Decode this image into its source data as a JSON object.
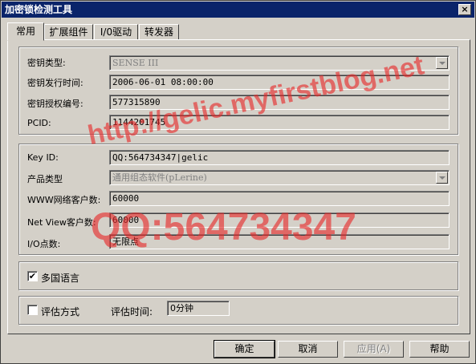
{
  "window": {
    "title": "加密锁检测工具",
    "close_glyph": "×"
  },
  "tabs": [
    {
      "label": "常用"
    },
    {
      "label": "扩展组件"
    },
    {
      "label": "I/0驱动"
    },
    {
      "label": "转发器"
    }
  ],
  "group1": {
    "key_type_label": "密钥类型:",
    "key_type_value": "SENSE III",
    "issue_time_label": "密钥发行时间:",
    "issue_time_value": "2006-06-01 08:00:00",
    "auth_no_label": "密钥授权编号:",
    "auth_no_value": "577315890",
    "pcid_label": "PCID:",
    "pcid_value": "1144201745"
  },
  "group2": {
    "key_id_label": "Key ID:",
    "key_id_value": "QQ:564734347|gelic",
    "product_type_label": "产品类型",
    "product_type_value": "通用组态软件(pLerine)",
    "www_clients_label": "WWW网络客户数:",
    "www_clients_value": "60000",
    "netview_clients_label": "Net View客户数:",
    "netview_clients_value": "60000",
    "io_points_label": "I/O点数:",
    "io_points_value": "无限点"
  },
  "group3": {
    "multilang_label": "多国语言",
    "multilang_checked": "✔"
  },
  "group4": {
    "eval_label": "评估方式",
    "eval_time_label": "评估时间:",
    "eval_time_value": "0分钟"
  },
  "buttons": {
    "ok": "确定",
    "cancel": "取消",
    "apply": "应用(A)",
    "help": "帮助"
  },
  "watermark": {
    "line1": "http://gelic.myfirstblog.net",
    "line2": "QQ:564734347"
  }
}
